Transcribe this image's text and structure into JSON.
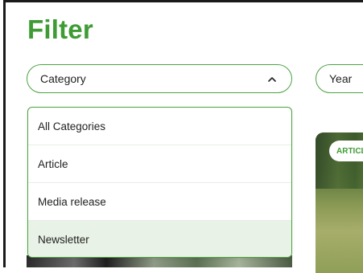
{
  "filter": {
    "title": "Filter",
    "category": {
      "label": "Category",
      "options": [
        {
          "label": "All Categories",
          "highlighted": false
        },
        {
          "label": "Article",
          "highlighted": false
        },
        {
          "label": "Media release",
          "highlighted": false
        },
        {
          "label": "Newsletter",
          "highlighted": true
        }
      ]
    },
    "year": {
      "label": "Year"
    }
  },
  "card": {
    "badge": "ARTICLE"
  },
  "colors": {
    "accent": "#3f9c35",
    "border": "#4aa33f",
    "hover": "#e9f2e6"
  },
  "icons": {
    "category_toggle": "chevron-up-icon"
  }
}
